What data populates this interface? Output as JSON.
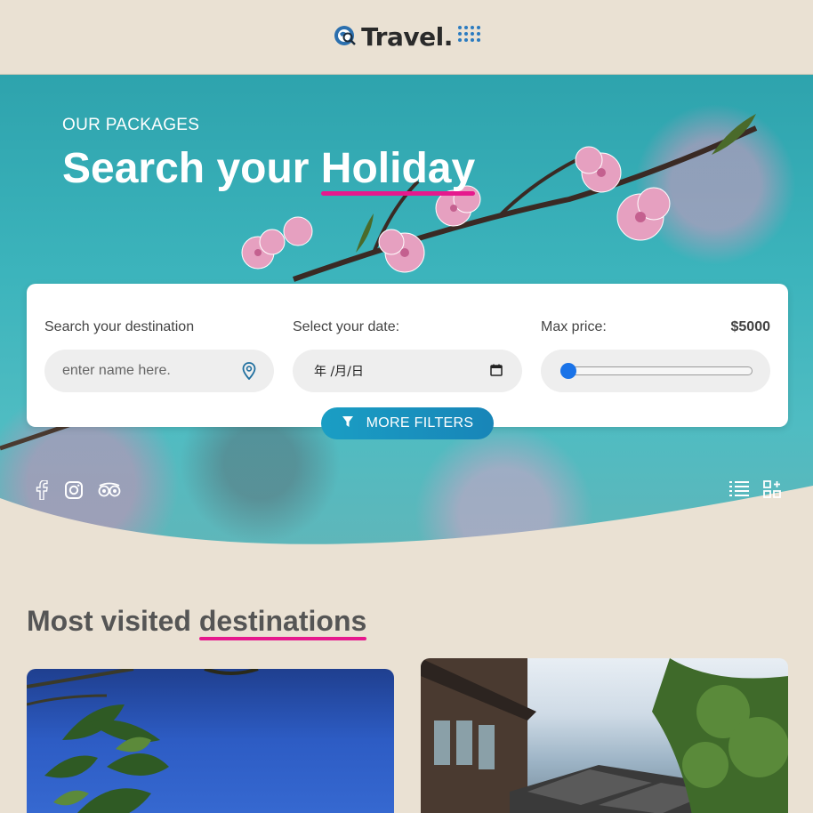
{
  "header": {
    "logo_text": "Travel.",
    "logo_icon": "search-globe-icon",
    "accent_color": "#2b7bc0"
  },
  "hero": {
    "subtitle": "OUR PACKAGES",
    "title_main": "Search your ",
    "title_highlight": "Holiday",
    "highlight_color": "#e6198d"
  },
  "search": {
    "destination_label": "Search your destination",
    "destination_placeholder": "enter name here.",
    "date_label": "Select your date:",
    "date_value": "年 /月/日",
    "price_label": "Max price:",
    "price_value": "$5000",
    "price_slider_fraction": 0.0,
    "more_filters_label": "MORE FILTERS"
  },
  "social": {
    "icons": [
      "facebook-icon",
      "instagram-icon",
      "tripadvisor-icon"
    ]
  },
  "view_toggle": {
    "icons": [
      "list-view-icon",
      "grid-view-icon"
    ]
  },
  "section": {
    "title_main": "Most visited ",
    "title_highlight": "destinations"
  },
  "cards": [
    {
      "image": "tropical-plant-blue-sky"
    },
    {
      "image": "old-japanese-street"
    }
  ]
}
